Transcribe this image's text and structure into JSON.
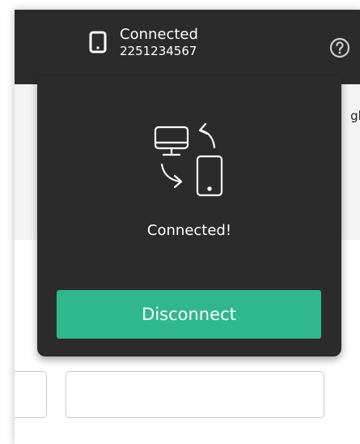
{
  "header": {
    "status_title": "Connected",
    "phone_number": "2251234567"
  },
  "popup": {
    "message": "Connected!",
    "disconnect_label": "Disconnect"
  },
  "background": {
    "partial_text": "gli"
  },
  "icons": {
    "phone": "phone-icon",
    "help": "help-question-icon",
    "sync": "device-sync-icon"
  },
  "colors": {
    "dark_panel": "#2b2b2b",
    "accent": "#2fb88b"
  }
}
